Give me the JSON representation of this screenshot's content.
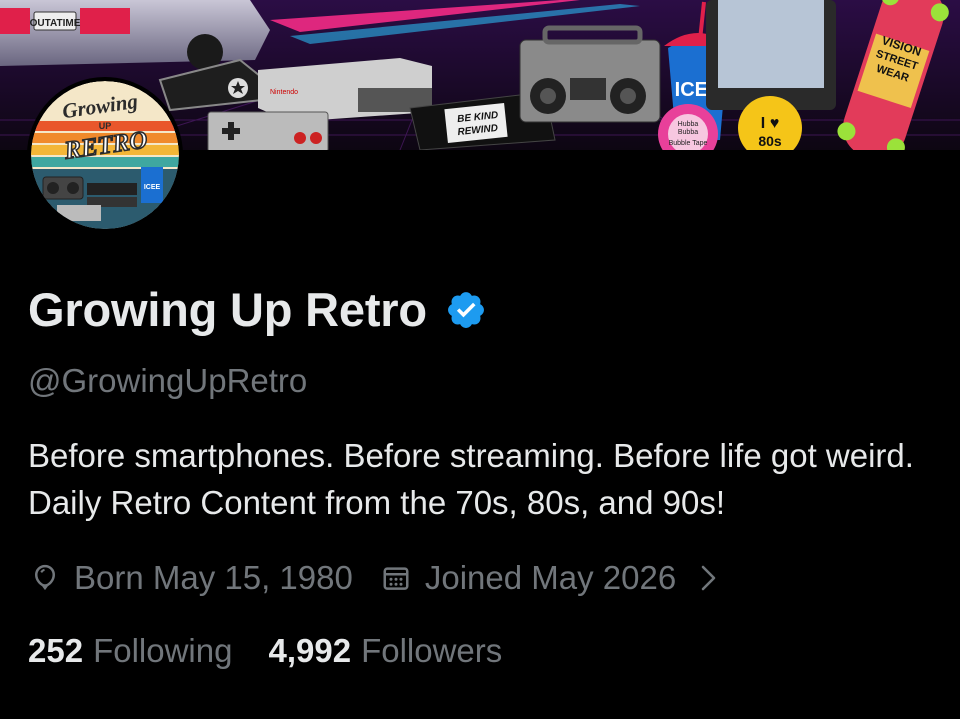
{
  "banner": {
    "license_plate": "OUTATIME",
    "vhs_label_line1": "BE KIND",
    "vhs_label_line2": "REWIND",
    "cup_brand": "ICEE",
    "gum_line1": "Hubba",
    "gum_line2": "Bubba",
    "gum_line3": "Bubble Tape",
    "badge_line1": "I ♥",
    "badge_line2": "80s",
    "skateboard_line1": "VISION",
    "skateboard_line2": "STREET",
    "skateboard_line3": "WEAR"
  },
  "avatar": {
    "logo_line1": "Growing",
    "logo_line2": "UP",
    "logo_line3": "RETRO",
    "logo_cup": "ICEE"
  },
  "profile": {
    "display_name": "Growing Up Retro",
    "handle": "@GrowingUpRetro",
    "bio": "Before smartphones. Before streaming. Before life got weird. Daily Retro Content from the 70s, 80s, and 90s!",
    "birthday": "Born May 15, 1980",
    "joined": "Joined May 2026"
  },
  "stats": {
    "following_count": "252",
    "following_label": "Following",
    "followers_count": "4,992",
    "followers_label": "Followers"
  },
  "colors": {
    "background": "#000000",
    "text_primary": "#e7e9ea",
    "text_secondary": "#71767b",
    "verified_blue": "#1d9bf0"
  },
  "icons": {
    "verified": "verified-badge-icon",
    "birthday": "balloon-icon",
    "joined": "calendar-icon",
    "more": "chevron-right-icon"
  }
}
